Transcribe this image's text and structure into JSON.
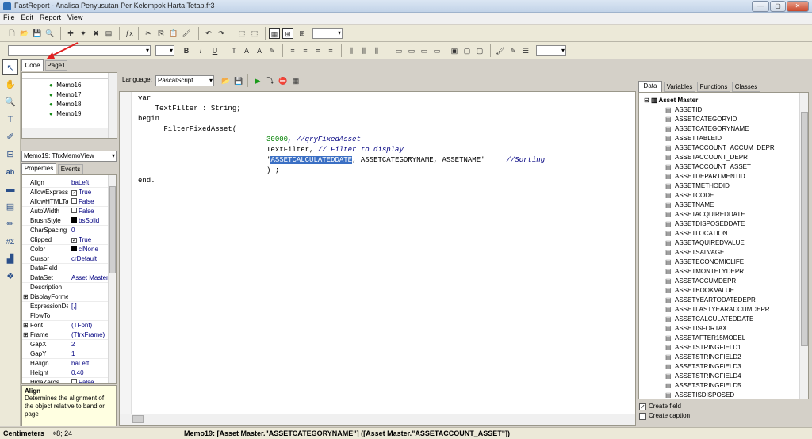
{
  "window": {
    "title": "FastReport - Analisa Penyusutan Per Kelompok Harta Tetap.fr3",
    "min": "—",
    "max": "▢",
    "close": "✕"
  },
  "menu": [
    "File",
    "Edit",
    "Report",
    "View"
  ],
  "tabs": {
    "code": "Code",
    "page1": "Page1"
  },
  "tree": [
    "Memo16",
    "Memo17",
    "Memo18",
    "Memo19"
  ],
  "object_selector": "Memo19: TfrxMemoView",
  "inspector": {
    "tabs": [
      "Properties",
      "Events"
    ],
    "rows": [
      [
        "Align",
        "baLeft",
        ""
      ],
      [
        "AllowExpress",
        "True",
        "chk"
      ],
      [
        "AllowHTMLTa",
        "False",
        "box"
      ],
      [
        "AutoWidth",
        "False",
        "box"
      ],
      [
        "BrushStyle",
        "bsSolid",
        "sq"
      ],
      [
        "CharSpacing",
        "0",
        ""
      ],
      [
        "Clipped",
        "True",
        "chk"
      ],
      [
        "Color",
        "clNone",
        "sq"
      ],
      [
        "Cursor",
        "crDefault",
        ""
      ],
      [
        "DataField",
        "",
        ""
      ],
      [
        "DataSet",
        "Asset Master",
        ""
      ],
      [
        "Description",
        "",
        ""
      ],
      [
        "DisplayForme",
        "",
        "plus"
      ],
      [
        "ExpressionDe",
        "[,]",
        ""
      ],
      [
        "FlowTo",
        "",
        ""
      ],
      [
        "Font",
        "(TFont)",
        "plus"
      ],
      [
        "Frame",
        "(TfrxFrame)",
        "plus"
      ],
      [
        "GapX",
        "2",
        ""
      ],
      [
        "GapY",
        "1",
        ""
      ],
      [
        "HAlign",
        "haLeft",
        ""
      ],
      [
        "Height",
        "0.40",
        ""
      ],
      [
        "HideZeros",
        "False",
        "box"
      ]
    ],
    "help_title": "Align",
    "help_text": "Determines the alignment of the object relative to band or page"
  },
  "code_toolbar": {
    "language_label": "Language:",
    "language_value": "PascalScript"
  },
  "code_lines": [
    {
      "a": "var"
    },
    {
      "a": "    TextFilter : String;"
    },
    {
      "a": ""
    },
    {
      "a": "begin"
    },
    {
      "a": "      FilterFixedAsset("
    },
    {
      "a": "                              ",
      "num": "30000",
      "cm": ", //qryFixedAsset"
    },
    {
      "a": "                              TextFilter, ",
      "cm": "// Filter to display"
    },
    {
      "a": "                              '",
      "hl": "ASSETCALCULATEDDATE",
      "b": ", ASSETCATEGORYNAME, ASSETNAME'",
      "cm": "     //Sorting"
    },
    {
      "a": "                              ) ;"
    },
    {
      "a": "end."
    }
  ],
  "right_tabs": [
    "Data",
    "Variables",
    "Functions",
    "Classes"
  ],
  "dataset": {
    "name": "Asset Master",
    "fields": [
      "ASSETID",
      "ASSETCATEGORYID",
      "ASSETCATEGORYNAME",
      "ASSETTABLEID",
      "ASSETACCOUNT_ACCUM_DEPR",
      "ASSETACCOUNT_DEPR",
      "ASSETACCOUNT_ASSET",
      "ASSETDEPARTMENTID",
      "ASSETMETHODID",
      "ASSETCODE",
      "ASSETNAME",
      "ASSETACQUIREDDATE",
      "ASSETDISPOSEDDATE",
      "ASSETLOCATION",
      "ASSETAQUIREDVALUE",
      "ASSETSALVAGE",
      "ASSETECONOMICLIFE",
      "ASSETMONTHLYDEPR",
      "ASSETACCUMDEPR",
      "ASSETBOOKVALUE",
      "ASSETYEARTODATEDEPR",
      "ASSETLASTYEARACCUMDEPR",
      "ASSETCALCULATEDDATE",
      "ASSETISFORTAX",
      "ASSETAFTER15MODEL",
      "ASSETSTRINGFIELD1",
      "ASSETSTRINGFIELD2",
      "ASSETSTRINGFIELD3",
      "ASSETSTRINGFIELD4",
      "ASSETSTRINGFIELD5",
      "ASSETISDISPOSED"
    ]
  },
  "create_field": "Create field",
  "create_caption": "Create caption",
  "status": {
    "units": "Centimeters",
    "pos": "8; 24",
    "info": "Memo19: [Asset Master.\"ASSETCATEGORYNAME\"] ([Asset Master.\"ASSETACCOUNT_ASSET\"])"
  }
}
